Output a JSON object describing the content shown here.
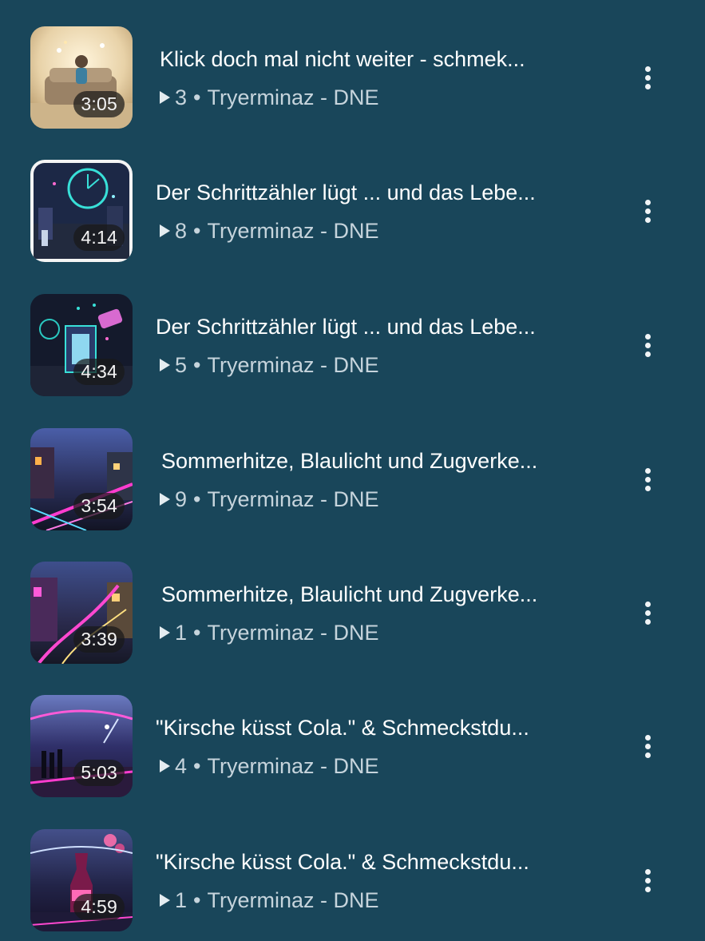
{
  "items": [
    {
      "duration": "3:05",
      "title": "Klick doch mal nicht weiter - schmek...",
      "plays": "3",
      "separator": "•",
      "channel": "Tryerminaz - DNE"
    },
    {
      "duration": "4:14",
      "title": "Der Schrittzähler lügt ... und das Lebe...",
      "plays": "8",
      "separator": "•",
      "channel": "Tryerminaz - DNE"
    },
    {
      "duration": "4:34",
      "title": "Der Schrittzähler lügt ... und das Lebe...",
      "plays": "5",
      "separator": "•",
      "channel": "Tryerminaz - DNE"
    },
    {
      "duration": "3:54",
      "title": "Sommerhitze, Blaulicht und Zugverke...",
      "plays": "9",
      "separator": "•",
      "channel": "Tryerminaz - DNE"
    },
    {
      "duration": "3:39",
      "title": "Sommerhitze, Blaulicht und Zugverke...",
      "plays": "1",
      "separator": "•",
      "channel": "Tryerminaz - DNE"
    },
    {
      "duration": "5:03",
      "title": "\"Kirsche küsst Cola.\" & Schmeckstdu...",
      "plays": "4",
      "separator": "•",
      "channel": "Tryerminaz - DNE"
    },
    {
      "duration": "4:59",
      "title": "\"Kirsche küsst Cola.\" & Schmeckstdu...",
      "plays": "1",
      "separator": "•",
      "channel": "Tryerminaz - DNE"
    }
  ],
  "icons": {
    "play": "play-icon",
    "more": "more-vertical-icon"
  },
  "colors": {
    "background": "#19465a",
    "title": "#ffffff",
    "meta": "#c6d4dc"
  }
}
